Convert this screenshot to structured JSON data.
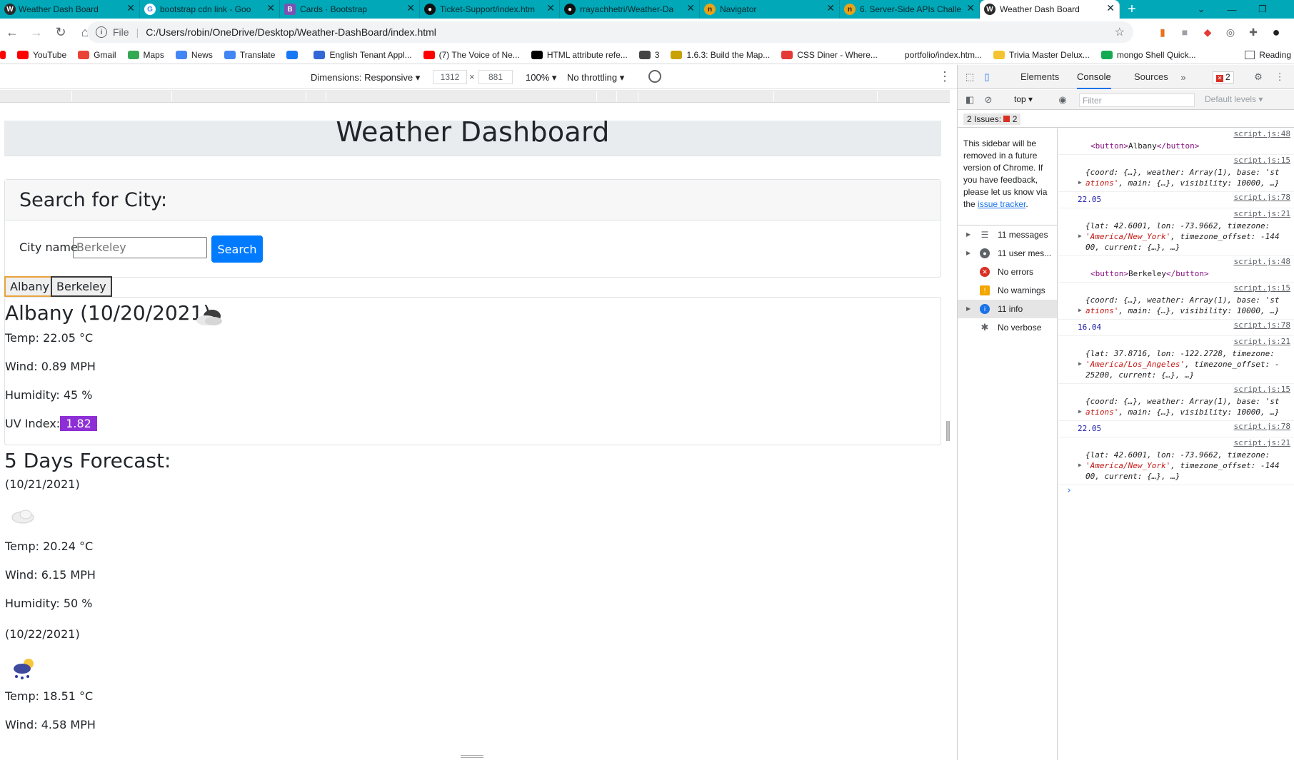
{
  "browser": {
    "tabs": [
      {
        "label": "Weather Dash Board",
        "icon": "W"
      },
      {
        "label": "bootstrap cdn link - Goo",
        "icon": "G"
      },
      {
        "label": "Cards · Bootstrap",
        "icon": "B"
      },
      {
        "label": "Ticket-Support/index.htm",
        "icon": "gh"
      },
      {
        "label": "rrayachhetri/Weather-Da",
        "icon": "gh"
      },
      {
        "label": "Navigator",
        "icon": "n"
      },
      {
        "label": "6. Server-Side APIs Challe",
        "icon": "n"
      },
      {
        "label": "Weather Dash Board",
        "icon": "W"
      }
    ],
    "url_scheme": "File",
    "url": "C:/Users/robin/OneDrive/Desktop/Weather-DashBoard/index.html",
    "bookmarks": [
      {
        "label": "YouTube",
        "color": "#ff0000"
      },
      {
        "label": "Gmail",
        "color": "#ea4335"
      },
      {
        "label": "Maps",
        "color": "#34a853"
      },
      {
        "label": "News",
        "color": "#4285f4"
      },
      {
        "label": "Translate",
        "color": "#4285f4"
      },
      {
        "label": "",
        "color": "#1877f2"
      },
      {
        "label": "English Tenant Appl...",
        "color": "#3367d6"
      },
      {
        "label": "(7) The Voice of Ne...",
        "color": "#ff0000"
      },
      {
        "label": "HTML attribute refe...",
        "color": "#000000"
      },
      {
        "label": "3",
        "color": "#444444"
      },
      {
        "label": "1.6.3: Build the Map...",
        "color": "#c9a100"
      },
      {
        "label": "CSS Diner - Where...",
        "color": "#e53935"
      },
      {
        "label": "portfolio/index.htm...",
        "color": "#ffffff"
      },
      {
        "label": "Trivia Master Delux...",
        "color": "#f4c430"
      },
      {
        "label": "mongo Shell Quick...",
        "color": "#13aa52"
      }
    ],
    "reading_list": "Reading"
  },
  "device_toolbar": {
    "dimensions": "Dimensions: Responsive",
    "width": "1312",
    "height": "881",
    "times": "×",
    "zoom": "100%",
    "throttling": "No throttling"
  },
  "page": {
    "title": "Weather Dashboard",
    "search_header": "Search for City:",
    "city_label": "City name",
    "city_value": "Berkeley",
    "search_button": "Search",
    "history": [
      "Albany",
      "Berkeley"
    ],
    "current": {
      "heading": "Albany (10/20/2021)",
      "icon": "cloud-icon",
      "temp": "Temp: 22.05 °C",
      "wind": "Wind: 0.89 MPH",
      "humidity": "Humidity: 45 %",
      "uv_label": "UV Index:",
      "uv_value": "1.82",
      "uv_color": "#8e2fd6"
    },
    "forecast_heading": "5 Days Forecast:",
    "forecast": [
      {
        "date": "(10/21/2021)",
        "icon": "cloud-icon",
        "temp": "Temp: 20.24 °C",
        "wind": "Wind: 6.15 MPH",
        "humidity": "Humidity: 50 %"
      },
      {
        "date": "(10/22/2021)",
        "icon": "rain-sun-icon",
        "temp": "Temp: 18.51 °C",
        "wind": "Wind: 4.58 MPH"
      }
    ]
  },
  "devtools": {
    "tabs": [
      "Elements",
      "Console",
      "Sources"
    ],
    "active_tab": "Console",
    "error_count": "2",
    "context": "top",
    "filter_placeholder": "Filter",
    "levels": "Default levels",
    "issues_label": "2 Issues:",
    "issues_count": "2",
    "sidebar_note": "This sidebar will be removed in a future version of Chrome. If you have feedback, please let us know via the",
    "sidebar_link": "issue tracker",
    "sidebar_items": [
      {
        "label": "11 messages",
        "icon": "list-icon"
      },
      {
        "label": "11 user mes...",
        "icon": "user-icon"
      },
      {
        "label": "No errors",
        "icon": "error-icon"
      },
      {
        "label": "No warnings",
        "icon": "warning-icon"
      },
      {
        "label": "11 info",
        "icon": "info-icon"
      },
      {
        "label": "No verbose",
        "icon": "verbose-icon"
      }
    ],
    "console": [
      {
        "src": "script.js:48",
        "kind": "tag",
        "open": "<button>",
        "text": "Albany",
        "close": "</button>"
      },
      {
        "src": "script.js:15",
        "kind": "obj",
        "l1": "{coord: {…}, weather: Array(1), base: 'st",
        "l2s": "ations'",
        "l2": ", main: {…}, visibility: 10000, …}"
      },
      {
        "src": "script.js:78",
        "kind": "num",
        "text": "22.05"
      },
      {
        "src": "script.js:21",
        "kind": "obj2",
        "l0": "{lat: 42.6001, lon: -73.9662, timezone:",
        "l1s": "'America/New_York'",
        "l1": ", timezone_offset: -144",
        "l2": "00, current: {…}, …}"
      },
      {
        "src": "script.js:48",
        "kind": "tag",
        "open": "<button>",
        "text": "Berkeley",
        "close": "</button>"
      },
      {
        "src": "script.js:15",
        "kind": "obj",
        "l1": "{coord: {…}, weather: Array(1), base: 'st",
        "l2s": "ations'",
        "l2": ", main: {…}, visibility: 10000, …}"
      },
      {
        "src": "script.js:78",
        "kind": "num",
        "text": "16.04"
      },
      {
        "src": "script.js:21",
        "kind": "obj2",
        "l0": "{lat: 37.8716, lon: -122.2728, timezone:",
        "l1s": "'America/Los_Angeles'",
        "l1": ", timezone_offset: -",
        "l2": "25200, current: {…}, …}"
      },
      {
        "src": "script.js:15",
        "kind": "obj",
        "l1": "{coord: {…}, weather: Array(1), base: 'st",
        "l2s": "ations'",
        "l2": ", main: {…}, visibility: 10000, …}"
      },
      {
        "src": "script.js:78",
        "kind": "num",
        "text": "22.05"
      },
      {
        "src": "script.js:21",
        "kind": "obj2",
        "l0": "{lat: 42.6001, lon: -73.9662, timezone:",
        "l1s": "'America/New_York'",
        "l1": ", timezone_offset: -144",
        "l2": "00, current: {…}, …}"
      }
    ]
  }
}
